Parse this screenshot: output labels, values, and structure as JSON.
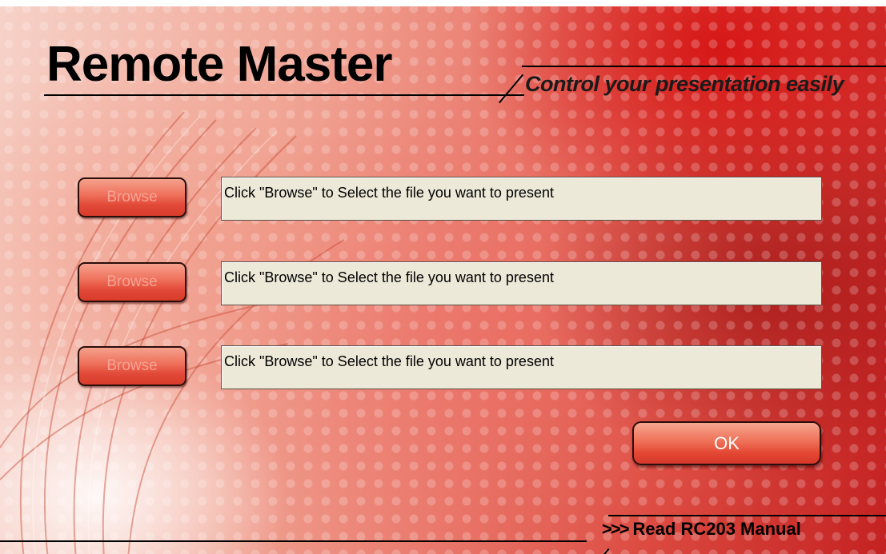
{
  "app": {
    "title": "Remote Master",
    "tagline": "Control your presentation easily"
  },
  "file_rows": [
    {
      "browse_label": "Browse",
      "field_text": "Click \"Browse\" to Select the file you want to present"
    },
    {
      "browse_label": "Browse",
      "field_text": "Click \"Browse\" to Select the file you want to present"
    },
    {
      "browse_label": "Browse",
      "field_text": "Click \"Browse\" to Select the file you want to present"
    }
  ],
  "ok_button": {
    "label": "OK"
  },
  "manual_link": {
    "arrows": ">>>",
    "label": "Read RC203 Manual"
  },
  "colors": {
    "accent_red": "#d93b2b",
    "button_text_muted": "#f6a294",
    "field_background": "#ece9d8"
  }
}
